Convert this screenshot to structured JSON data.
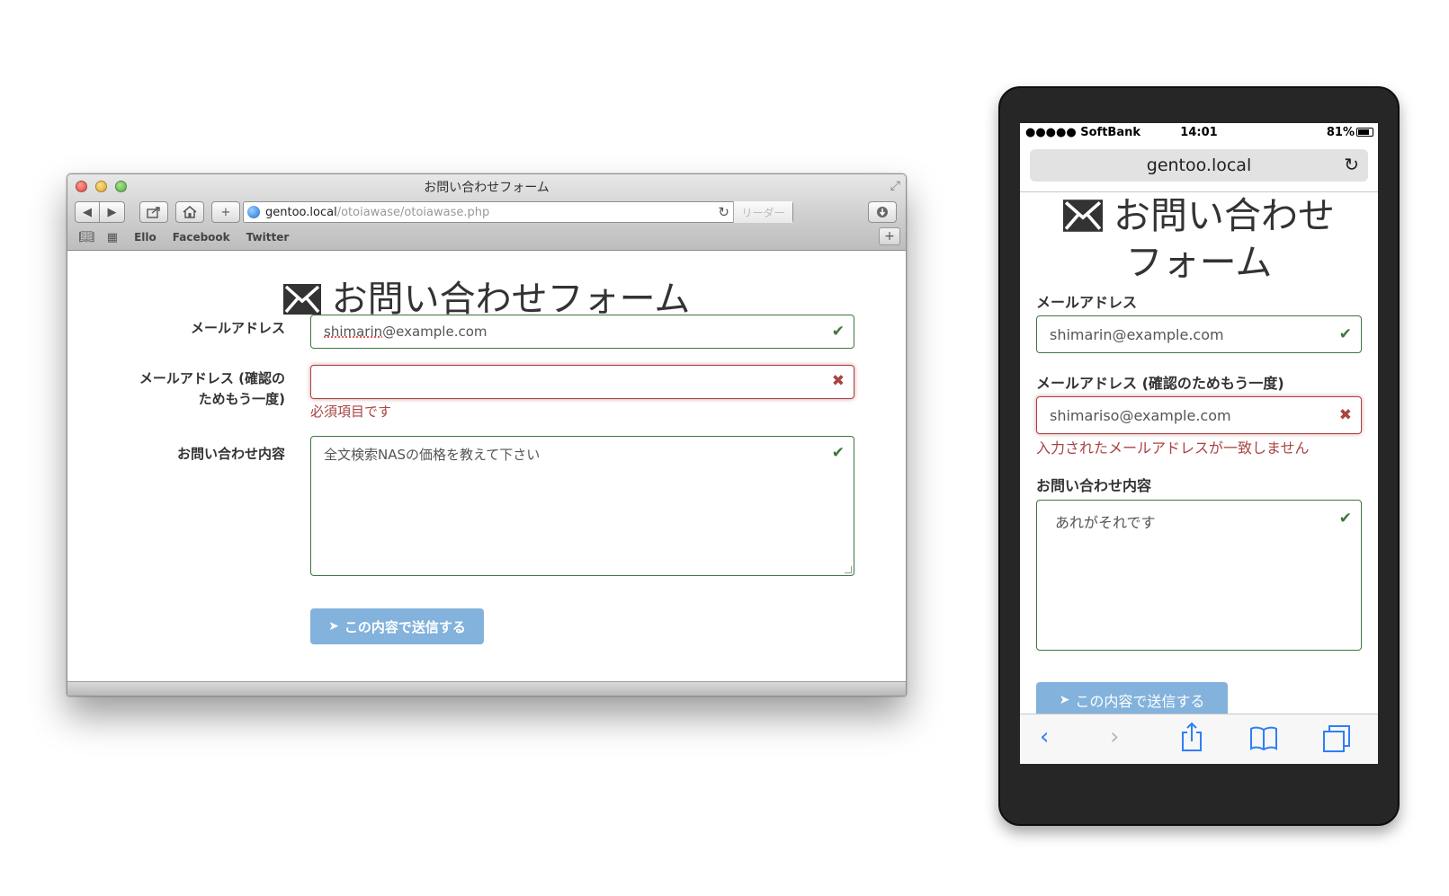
{
  "desktop": {
    "window_title": "お問い合わせフォーム",
    "toolbar": {
      "back": "◀",
      "forward": "▶",
      "add": "+",
      "reader": "リーダー"
    },
    "url": {
      "host": "gentoo.local",
      "path": "/otoiawase/otoiawase.php"
    },
    "bookmarks": [
      "Ello",
      "Facebook",
      "Twitter"
    ],
    "form": {
      "heading": "お問い合わせフォーム",
      "email_label": "メールアドレス",
      "email_value_misspelled": "shimarin",
      "email_value_rest": "@example.com",
      "confirm_label_line1": "メールアドレス (確認の",
      "confirm_label_line2": "ためもう一度)",
      "confirm_value": "",
      "confirm_error": "必須項目です",
      "message_label": "お問い合わせ内容",
      "message_value": "全文検索NASの価格を教えて下さい",
      "submit_label": "この内容で送信する"
    }
  },
  "phone": {
    "status": {
      "carrier": "●●●●● SoftBank",
      "time": "14:01",
      "battery": "81%"
    },
    "address": "gentoo.local",
    "form": {
      "heading_line1": "お問い合わせ",
      "heading_line2": "フォーム",
      "email_label": "メールアドレス",
      "email_value": "shimarin@example.com",
      "confirm_label": "メールアドレス (確認のためもう一度)",
      "confirm_value": "shimariso@example.com",
      "confirm_error": "入力されたメールアドレスが一致しません",
      "message_label": "お問い合わせ内容",
      "message_value": "あれがそれです",
      "submit_label": "この内容で送信する"
    },
    "toolbar_icons": [
      "back-icon",
      "forward-icon",
      "share-icon",
      "bookmarks-icon",
      "tabs-icon"
    ]
  },
  "colors": {
    "success": "#3c763d",
    "error": "#a94442",
    "button": "#83b2dc",
    "ios_blue": "#2f7ff7"
  }
}
